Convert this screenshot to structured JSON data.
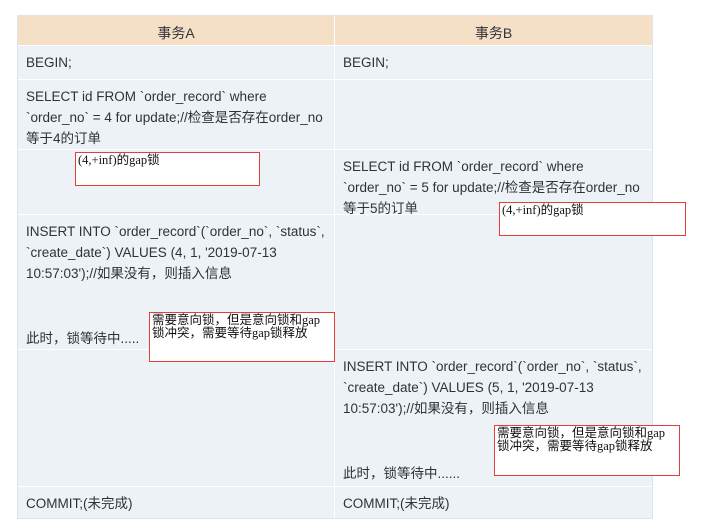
{
  "header": {
    "col_a": "事务A",
    "col_b": "事务B"
  },
  "rows": {
    "r1": {
      "a": "BEGIN;",
      "b": "BEGIN;"
    },
    "r2": {
      "a": "SELECT id FROM  `order_record` where `order_no` = 4 for update;//检查是否存在order_no等于4的订单",
      "b": ""
    },
    "r3": {
      "a": "",
      "b": "SELECT id FROM `order_record` where `order_no` = 5 for update;//检查是否存在order_no等于5的订单"
    },
    "r4": {
      "a_sql": "INSERT INTO `order_record`(`order_no`, `status`, `create_date`) VALUES (4, 1, '2019-07-13 10:57:03');//如果没有，则插入信息",
      "a_wait": "此时，锁等待中.....",
      "b": ""
    },
    "r5": {
      "a": "",
      "b_sql": "INSERT INTO `order_record`(`order_no`, `status`, `create_date`) VALUES (5, 1, '2019-07-13 10:57:03');//如果没有，则插入信息",
      "b_wait": "此时，锁等待中......"
    },
    "r6": {
      "a": "COMMIT;(未完成)",
      "b": "COMMIT;(未完成)"
    }
  },
  "notes": {
    "gap_a": "(4,+inf)的gap锁",
    "gap_b": "(4,+inf)的gap锁",
    "conflict_a": "需要意向锁，但是意向锁和gap锁冲突，需要等待gap锁释放",
    "conflict_b": "需要意向锁，但是意向锁和gap锁冲突，需要等待gap锁释放"
  },
  "colors": {
    "header_bg": "#f6dfc7",
    "cell_bg": "#edf2f7",
    "note_border": "#e23f38"
  }
}
